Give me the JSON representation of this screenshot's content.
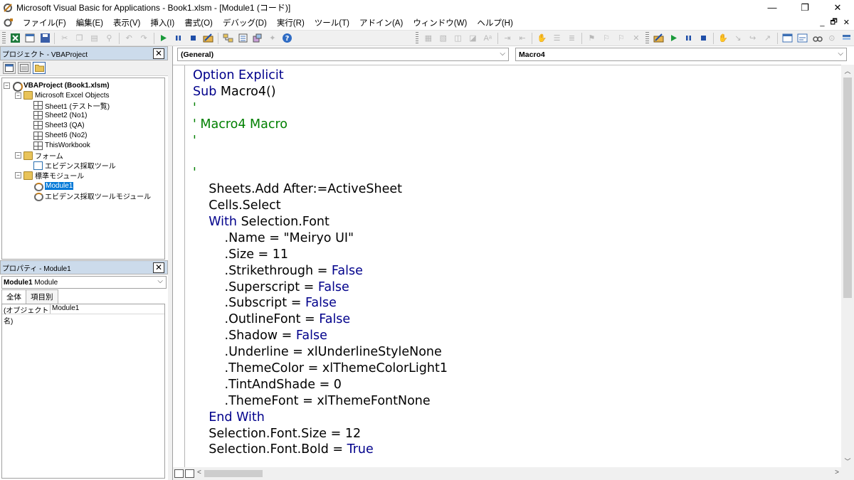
{
  "window": {
    "title": "Microsoft Visual Basic for Applications - Book1.xlsm - [Module1 (コード)]",
    "minimize": "—",
    "restore": "❐",
    "close": "✕"
  },
  "menu": {
    "items": [
      "ファイル(F)",
      "編集(E)",
      "表示(V)",
      "挿入(I)",
      "書式(O)",
      "デバッグ(D)",
      "実行(R)",
      "ツール(T)",
      "アドイン(A)",
      "ウィンドウ(W)",
      "ヘルプ(H)"
    ],
    "mdi_minimize": "_",
    "mdi_restore": "🗗",
    "mdi_close": "✕"
  },
  "project": {
    "title": "プロジェクト - VBAProject",
    "close": "✕",
    "tree": [
      {
        "label": "VBAProject (Book1.xlsm)",
        "icon": "project-icon",
        "level": 0,
        "expander": "−",
        "bold": true
      },
      {
        "label": "Microsoft Excel Objects",
        "icon": "folder-icon",
        "level": 1,
        "expander": "−"
      },
      {
        "label": "Sheet1 (テスト一覧)",
        "icon": "sheet-icon",
        "level": 2
      },
      {
        "label": "Sheet2 (No1)",
        "icon": "sheet-icon",
        "level": 2
      },
      {
        "label": "Sheet3 (QA)",
        "icon": "sheet-icon",
        "level": 2
      },
      {
        "label": "Sheet6 (No2)",
        "icon": "sheet-icon",
        "level": 2
      },
      {
        "label": "ThisWorkbook",
        "icon": "workbook-icon",
        "level": 2
      },
      {
        "label": "フォーム",
        "icon": "folder-icon",
        "level": 1,
        "expander": "−"
      },
      {
        "label": "エビデンス採取ツール",
        "icon": "form-icon",
        "level": 2
      },
      {
        "label": "標準モジュール",
        "icon": "folder-icon",
        "level": 1,
        "expander": "−"
      },
      {
        "label": "Module1",
        "icon": "module-icon",
        "level": 2,
        "selected": true
      },
      {
        "label": "エビデンス採取ツールモジュール",
        "icon": "module-icon",
        "level": 2
      }
    ]
  },
  "properties": {
    "title": "プロパティ - Module1",
    "close": "✕",
    "object_name": "Module1",
    "object_type": "Module",
    "tabs": [
      "全体",
      "項目別"
    ],
    "rows": [
      {
        "name": "(オブジェクト名)",
        "value": "Module1"
      }
    ]
  },
  "code": {
    "object_combo": "(General)",
    "proc_combo": "Macro4",
    "lines": [
      [
        {
          "t": "Option Explicit",
          "c": "kw"
        }
      ],
      [
        {
          "t": "Sub ",
          "c": "kw"
        },
        {
          "t": "Macro4()",
          "c": "tx"
        }
      ],
      [
        {
          "t": "'",
          "c": "cm"
        }
      ],
      [
        {
          "t": "' Macro4 Macro",
          "c": "cm"
        }
      ],
      [
        {
          "t": "'",
          "c": "cm"
        }
      ],
      [],
      [
        {
          "t": "'",
          "c": "cm"
        }
      ],
      [
        {
          "t": "    Sheets.Add After:=ActiveSheet",
          "c": "tx"
        }
      ],
      [
        {
          "t": "    Cells.Select",
          "c": "tx"
        }
      ],
      [
        {
          "t": "    With ",
          "c": "kw"
        },
        {
          "t": "Selection.Font",
          "c": "tx"
        }
      ],
      [
        {
          "t": "        .Name = \"Meiryo UI\"",
          "c": "tx"
        }
      ],
      [
        {
          "t": "        .Size = 11",
          "c": "tx"
        }
      ],
      [
        {
          "t": "        .Strikethrough = ",
          "c": "tx"
        },
        {
          "t": "False",
          "c": "kw"
        }
      ],
      [
        {
          "t": "        .Superscript = ",
          "c": "tx"
        },
        {
          "t": "False",
          "c": "kw"
        }
      ],
      [
        {
          "t": "        .Subscript = ",
          "c": "tx"
        },
        {
          "t": "False",
          "c": "kw"
        }
      ],
      [
        {
          "t": "        .OutlineFont = ",
          "c": "tx"
        },
        {
          "t": "False",
          "c": "kw"
        }
      ],
      [
        {
          "t": "        .Shadow = ",
          "c": "tx"
        },
        {
          "t": "False",
          "c": "kw"
        }
      ],
      [
        {
          "t": "        .Underline = xlUnderlineStyleNone",
          "c": "tx"
        }
      ],
      [
        {
          "t": "        .ThemeColor = xlThemeColorLight1",
          "c": "tx"
        }
      ],
      [
        {
          "t": "        .TintAndShade = 0",
          "c": "tx"
        }
      ],
      [
        {
          "t": "        .ThemeFont = xlThemeFontNone",
          "c": "tx"
        }
      ],
      [
        {
          "t": "    End With",
          "c": "kw"
        }
      ],
      [
        {
          "t": "    Selection.Font.Size = 12",
          "c": "tx"
        }
      ],
      [
        {
          "t": "    Selection.Font.Bold = ",
          "c": "tx"
        },
        {
          "t": "True",
          "c": "kw"
        }
      ]
    ]
  }
}
